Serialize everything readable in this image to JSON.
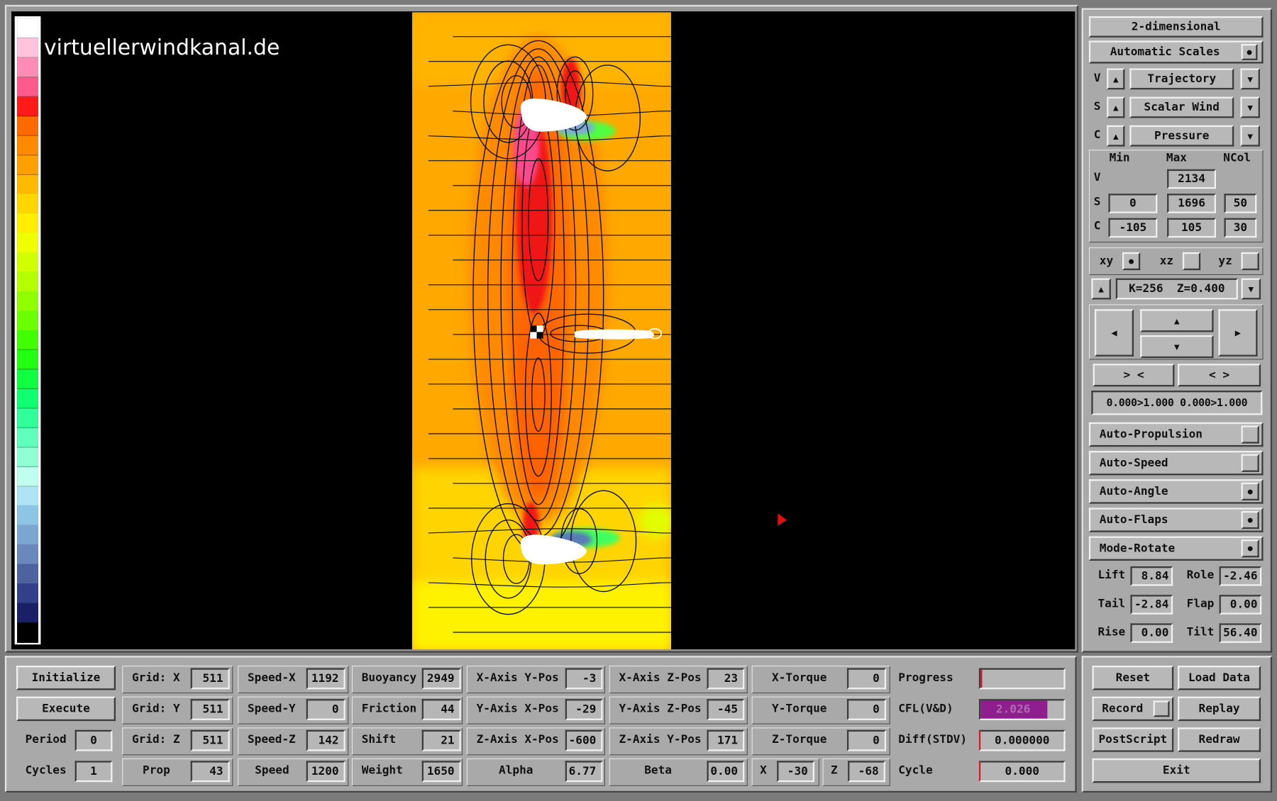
{
  "watermark": "virtuellerwindkanal.de",
  "colors": {
    "pressure_high": "#e5141e",
    "pressure_low": "#ffe600",
    "background": "#000000",
    "panel": "#a9a9a9",
    "accent_cfl": "#8f1f8f"
  },
  "colorbar": [
    "#ffffff",
    "#ffc4dc",
    "#ff8cb4",
    "#ff5a8c",
    "#ff1a1a",
    "#ff6a00",
    "#ff8a00",
    "#ffa000",
    "#ffba00",
    "#ffd600",
    "#ffee00",
    "#f0ff00",
    "#d2ff00",
    "#b4ff00",
    "#90ff00",
    "#6cff00",
    "#42ff00",
    "#22ff10",
    "#10ff40",
    "#10ff70",
    "#30ff9a",
    "#60ffbc",
    "#90ffd6",
    "#c0fff0",
    "#aee4f4",
    "#8ec4e4",
    "#7aa6d0",
    "#6a88bc",
    "#4e62a0",
    "#32408a",
    "#1a2066",
    "#000000"
  ],
  "right_panel": {
    "mode": "2-dimensional",
    "auto_scales": "Automatic Scales",
    "v_row": {
      "key": "V",
      "value": "Trajectory"
    },
    "s_row": {
      "key": "S",
      "value": "Scalar Wind"
    },
    "c_row": {
      "key": "C",
      "value": "Pressure"
    },
    "scale_headers": {
      "min": "Min",
      "max": "Max",
      "ncol": "NCol"
    },
    "v_scale": {
      "key": "V",
      "max": "2134"
    },
    "s_scale": {
      "key": "S",
      "min": "0",
      "max": "1696",
      "ncol": "50"
    },
    "c_scale": {
      "key": "C",
      "min": "-105",
      "max": "105",
      "ncol": "30"
    },
    "planes": {
      "xy": "xy",
      "xz": "xz",
      "yz": "yz"
    },
    "slice": "K=256  Z=0.400",
    "zoom_in": "> <",
    "zoom_out": "< >",
    "range": "0.000>1.000 0.000>1.000",
    "toggles": [
      "Auto-Propulsion",
      "Auto-Speed",
      "Auto-Angle",
      "Auto-Flaps",
      "Mode-Rotate"
    ],
    "forces": {
      "lift": {
        "label": "Lift",
        "value": "8.84"
      },
      "role": {
        "label": "Role",
        "value": "-2.46"
      },
      "tail": {
        "label": "Tail",
        "value": "-2.84"
      },
      "flap": {
        "label": "Flap",
        "value": "0.00"
      },
      "rise": {
        "label": "Rise",
        "value": "0.00"
      },
      "tilt": {
        "label": "Tilt",
        "value": "56.40"
      }
    }
  },
  "bottom": {
    "initialize": "Initialize",
    "execute": "Execute",
    "period": {
      "label": "Period",
      "value": "0"
    },
    "cycles": {
      "label": "Cycles",
      "value": "1"
    },
    "grid_x": {
      "label": "Grid: X",
      "value": "511"
    },
    "grid_y": {
      "label": "Grid: Y",
      "value": "511"
    },
    "grid_z": {
      "label": "Grid: Z",
      "value": "511"
    },
    "prop": {
      "label": "Prop",
      "value": "43"
    },
    "speed_x": {
      "label": "Speed-X",
      "value": "1192"
    },
    "speed_y": {
      "label": "Speed-Y",
      "value": "0"
    },
    "speed_z": {
      "label": "Speed-Z",
      "value": "142"
    },
    "speed": {
      "label": "Speed",
      "value": "1200"
    },
    "buoyancy": {
      "label": "Buoyancy",
      "value": "2949"
    },
    "friction": {
      "label": "Friction",
      "value": "44"
    },
    "shift": {
      "label": "Shift",
      "value": "21"
    },
    "weight": {
      "label": "Weight",
      "value": "1650"
    },
    "x_axis_y_pos": {
      "label": "X-Axis Y-Pos",
      "value": "-3"
    },
    "y_axis_x_pos": {
      "label": "Y-Axis X-Pos",
      "value": "-29"
    },
    "z_axis_x_pos": {
      "label": "Z-Axis X-Pos",
      "value": "-600"
    },
    "alpha": {
      "label": "Alpha",
      "value": "6.77"
    },
    "x_axis_z_pos": {
      "label": "X-Axis Z-Pos",
      "value": "23"
    },
    "y_axis_z_pos": {
      "label": "Y-Axis Z-Pos",
      "value": "-45"
    },
    "z_axis_y_pos": {
      "label": "Z-Axis Y-Pos",
      "value": "171"
    },
    "beta": {
      "label": "Beta",
      "value": "0.00"
    },
    "x_torque": {
      "label": "X-Torque",
      "value": "0"
    },
    "y_torque": {
      "label": "Y-Torque",
      "value": "0"
    },
    "z_torque": {
      "label": "Z-Torque",
      "value": "0"
    },
    "x_val": {
      "label": "X",
      "value": "-30"
    },
    "z_val": {
      "label": "Z",
      "value": "-68"
    },
    "progress": {
      "label": "Progress",
      "value": ""
    },
    "cfl": {
      "label": "CFL(V&D)",
      "value": "2.026"
    },
    "diff": {
      "label": "Diff(STDV)",
      "value": "0.000000"
    },
    "cycle": {
      "label": "Cycle",
      "value": "0.000"
    }
  },
  "actions": {
    "reset": "Reset",
    "load": "Load Data",
    "record": "Record",
    "replay": "Replay",
    "postscript": "PostScript",
    "redraw": "Redraw",
    "exit": "Exit"
  }
}
